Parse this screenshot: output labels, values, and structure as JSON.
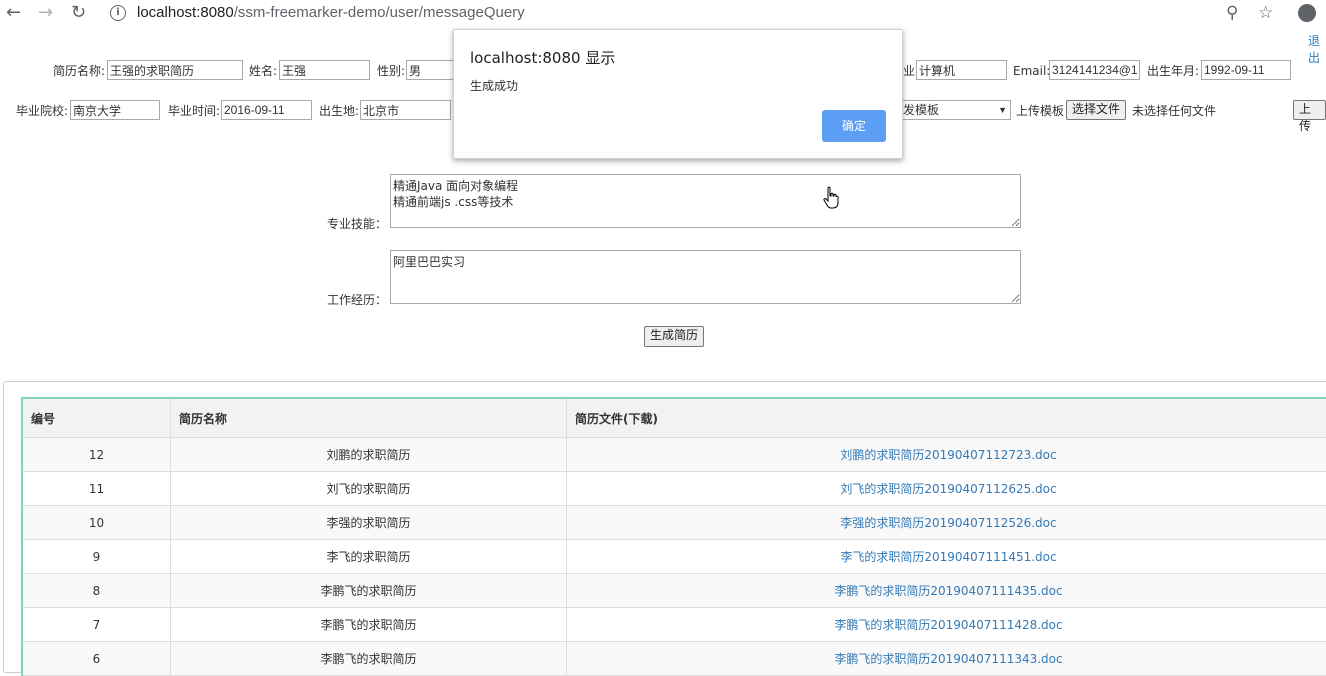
{
  "browser": {
    "url_host": "localhost:8080",
    "url_path": "/ssm-freemarker-demo/user/messageQuery"
  },
  "top_right_link": "退出",
  "form": {
    "resume_name_label": "简历名称:",
    "resume_name_value": "王强的求职简历",
    "name_label": "姓名:",
    "name_value": "王强",
    "gender_label": "性别:",
    "gender_value": "男",
    "major_label": "业:",
    "major_value": "计算机",
    "email_label": "Email:",
    "email_value": "3124141234@1",
    "birth_label": "出生年月:",
    "birth_value": "1992-09-11",
    "school_label": "毕业院校:",
    "school_value": "南京大学",
    "grad_time_label": "毕业时间:",
    "grad_time_value": "2016-09-11",
    "birthplace_label": "出生地:",
    "birthplace_value": "北京市",
    "template_select_value": "发模板",
    "upload_template_label": "上传模板",
    "choose_file_button": "选择文件",
    "no_file_text": "未选择任何文件",
    "upload_button": "上传",
    "skills_label": "专业技能：",
    "skills_value": "精通Java 面向对象编程\n精通前端js .css等技术",
    "experience_label": "工作经历：",
    "experience_value": "阿里巴巴实习",
    "generate_button": "生成简历"
  },
  "dialog": {
    "title": "localhost:8080 显示",
    "message": "生成成功",
    "ok_button": "确定"
  },
  "table": {
    "headers": [
      "编号",
      "简历名称",
      "简历文件(下载)"
    ],
    "rows": [
      {
        "id": "12",
        "name": "刘鹏的求职简历",
        "file": "刘鹏的求职简历20190407112723.doc"
      },
      {
        "id": "11",
        "name": "刘飞的求职简历",
        "file": "刘飞的求职简历20190407112625.doc"
      },
      {
        "id": "10",
        "name": "李强的求职简历",
        "file": "李强的求职简历20190407112526.doc"
      },
      {
        "id": "9",
        "name": "李飞的求职简历",
        "file": "李飞的求职简历20190407111451.doc"
      },
      {
        "id": "8",
        "name": "李鹏飞的求职简历",
        "file": "李鹏飞的求职简历20190407111435.doc"
      },
      {
        "id": "7",
        "name": "李鹏飞的求职简历",
        "file": "李鹏飞的求职简历20190407111428.doc"
      },
      {
        "id": "6",
        "name": "李鹏飞的求职简历",
        "file": "李鹏飞的求职简历20190407111343.doc"
      }
    ]
  }
}
